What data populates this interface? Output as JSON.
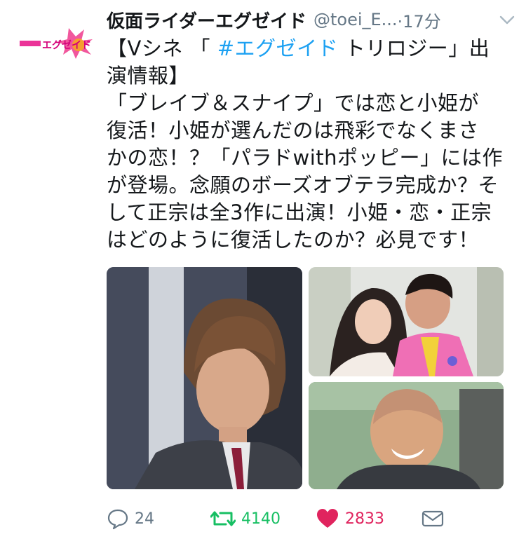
{
  "tweet": {
    "avatar_logo_text": "エグゼイド",
    "author_name": "仮面ライダーエグゼイド",
    "handle": "@toei_E...",
    "time": "·17分",
    "text_lines": [
      {
        "before": "【Vシネ 「 ",
        "hashtag": "#エグゼイド",
        "after": " トリロジー」出"
      },
      "演情報】",
      "「ブレイブ＆スナイプ」では恋と小姫が",
      "復活！小姫が選んだのは飛彩でなくまさ",
      "かの恋！？「パラドwithポッピー」には作",
      "が登場。念願のボーズオブテラ完成か？そ",
      "して正宗は全3作に出演！小姫・恋・正宗",
      "はどのように復活したのか？必見です！"
    ]
  },
  "actions": {
    "reply_count": "24",
    "retweet_count": "4140",
    "like_count": "2833"
  },
  "colors": {
    "retweet": "#17bf63",
    "like": "#e0245e",
    "icon_gray": "#657786",
    "hashtag": "#1da1f2"
  }
}
